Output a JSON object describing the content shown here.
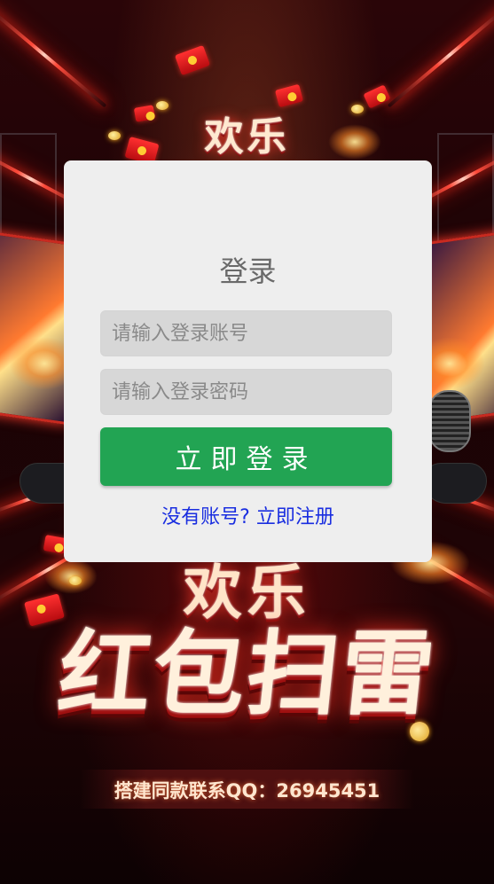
{
  "background": {
    "logo_top": "欢乐",
    "logo_mid": "欢乐",
    "logo_main": "红包扫雷",
    "contact_text": "搭建同款联系QQ：26945451"
  },
  "login": {
    "title": "登录",
    "account_placeholder": "请输入登录账号",
    "password_placeholder": "请输入登录密码",
    "submit_label": "立即登录",
    "register_link": "没有账号? 立即注册"
  },
  "colors": {
    "card_bg": "#eeeeee",
    "input_bg": "#d7d7d7",
    "button_green": "#22a453",
    "link_blue": "#1a2ee0",
    "neon_red": "#ff4a3a"
  },
  "icons": [
    "red-envelope-icon",
    "coin-icon",
    "game-controller-icon",
    "microphone-icon",
    "spark-icon"
  ]
}
